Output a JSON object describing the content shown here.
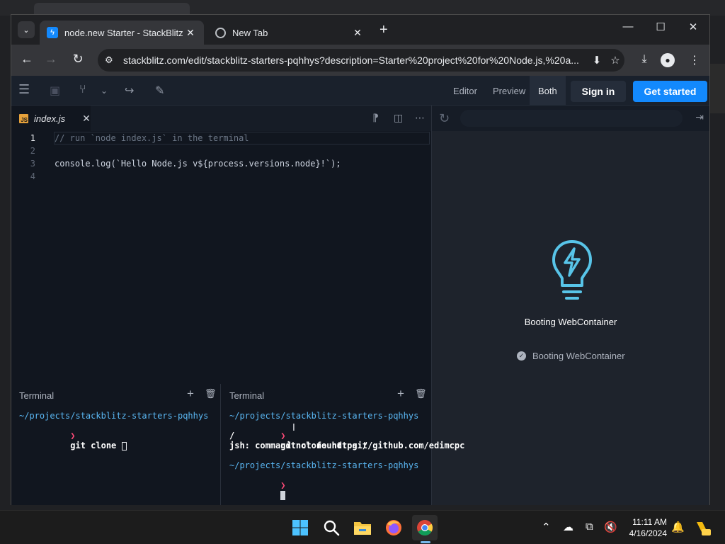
{
  "browser": {
    "tabs": [
      {
        "title": "node.new Starter - StackBlitz",
        "favicon": "bolt-icon",
        "active": true
      },
      {
        "title": "New Tab",
        "favicon": "chrome-icon",
        "active": false
      }
    ],
    "url": "stackblitz.com/edit/stackblitz-starters-pqhhys?description=Starter%20project%20for%20Node.js,%20a..."
  },
  "stackblitz": {
    "views": {
      "editor": "Editor",
      "preview": "Preview",
      "both": "Both"
    },
    "sign_in": "Sign in",
    "get_started": "Get started",
    "file_tab": {
      "name": "index.js",
      "badge": "JS"
    },
    "code_lines": [
      {
        "number": "1",
        "text": "// run `node index.js` in the terminal"
      },
      {
        "number": "2",
        "text": ""
      },
      {
        "number": "3",
        "text": "console.log(`Hello Node.js v${process.versions.node}!`);"
      },
      {
        "number": "4",
        "text": ""
      }
    ],
    "preview": {
      "boot_title": "Booting WebContainer",
      "boot_status": "Booting WebContainer"
    },
    "terminal1": {
      "label": "Terminal",
      "path": "~/projects/stackblitz-starters-pqhhys",
      "prompt": "❯",
      "command": "git clone "
    },
    "terminal2": {
      "label": "Terminal",
      "path1": "~/projects/stackblitz-starters-pqhhys",
      "prompt": "❯",
      "command": "git clone https://github.com/edimcpc",
      "command_wrap": "/",
      "error": "jsh: command not found: git",
      "path2": "~/projects/stackblitz-starters-pqhhys"
    }
  },
  "taskbar": {
    "time": "11:11 AM",
    "date": "4/16/2024"
  },
  "colors": {
    "accent": "#1389fd",
    "terminal_path": "#5ab7f3",
    "terminal_prompt": "#ff4a78"
  }
}
